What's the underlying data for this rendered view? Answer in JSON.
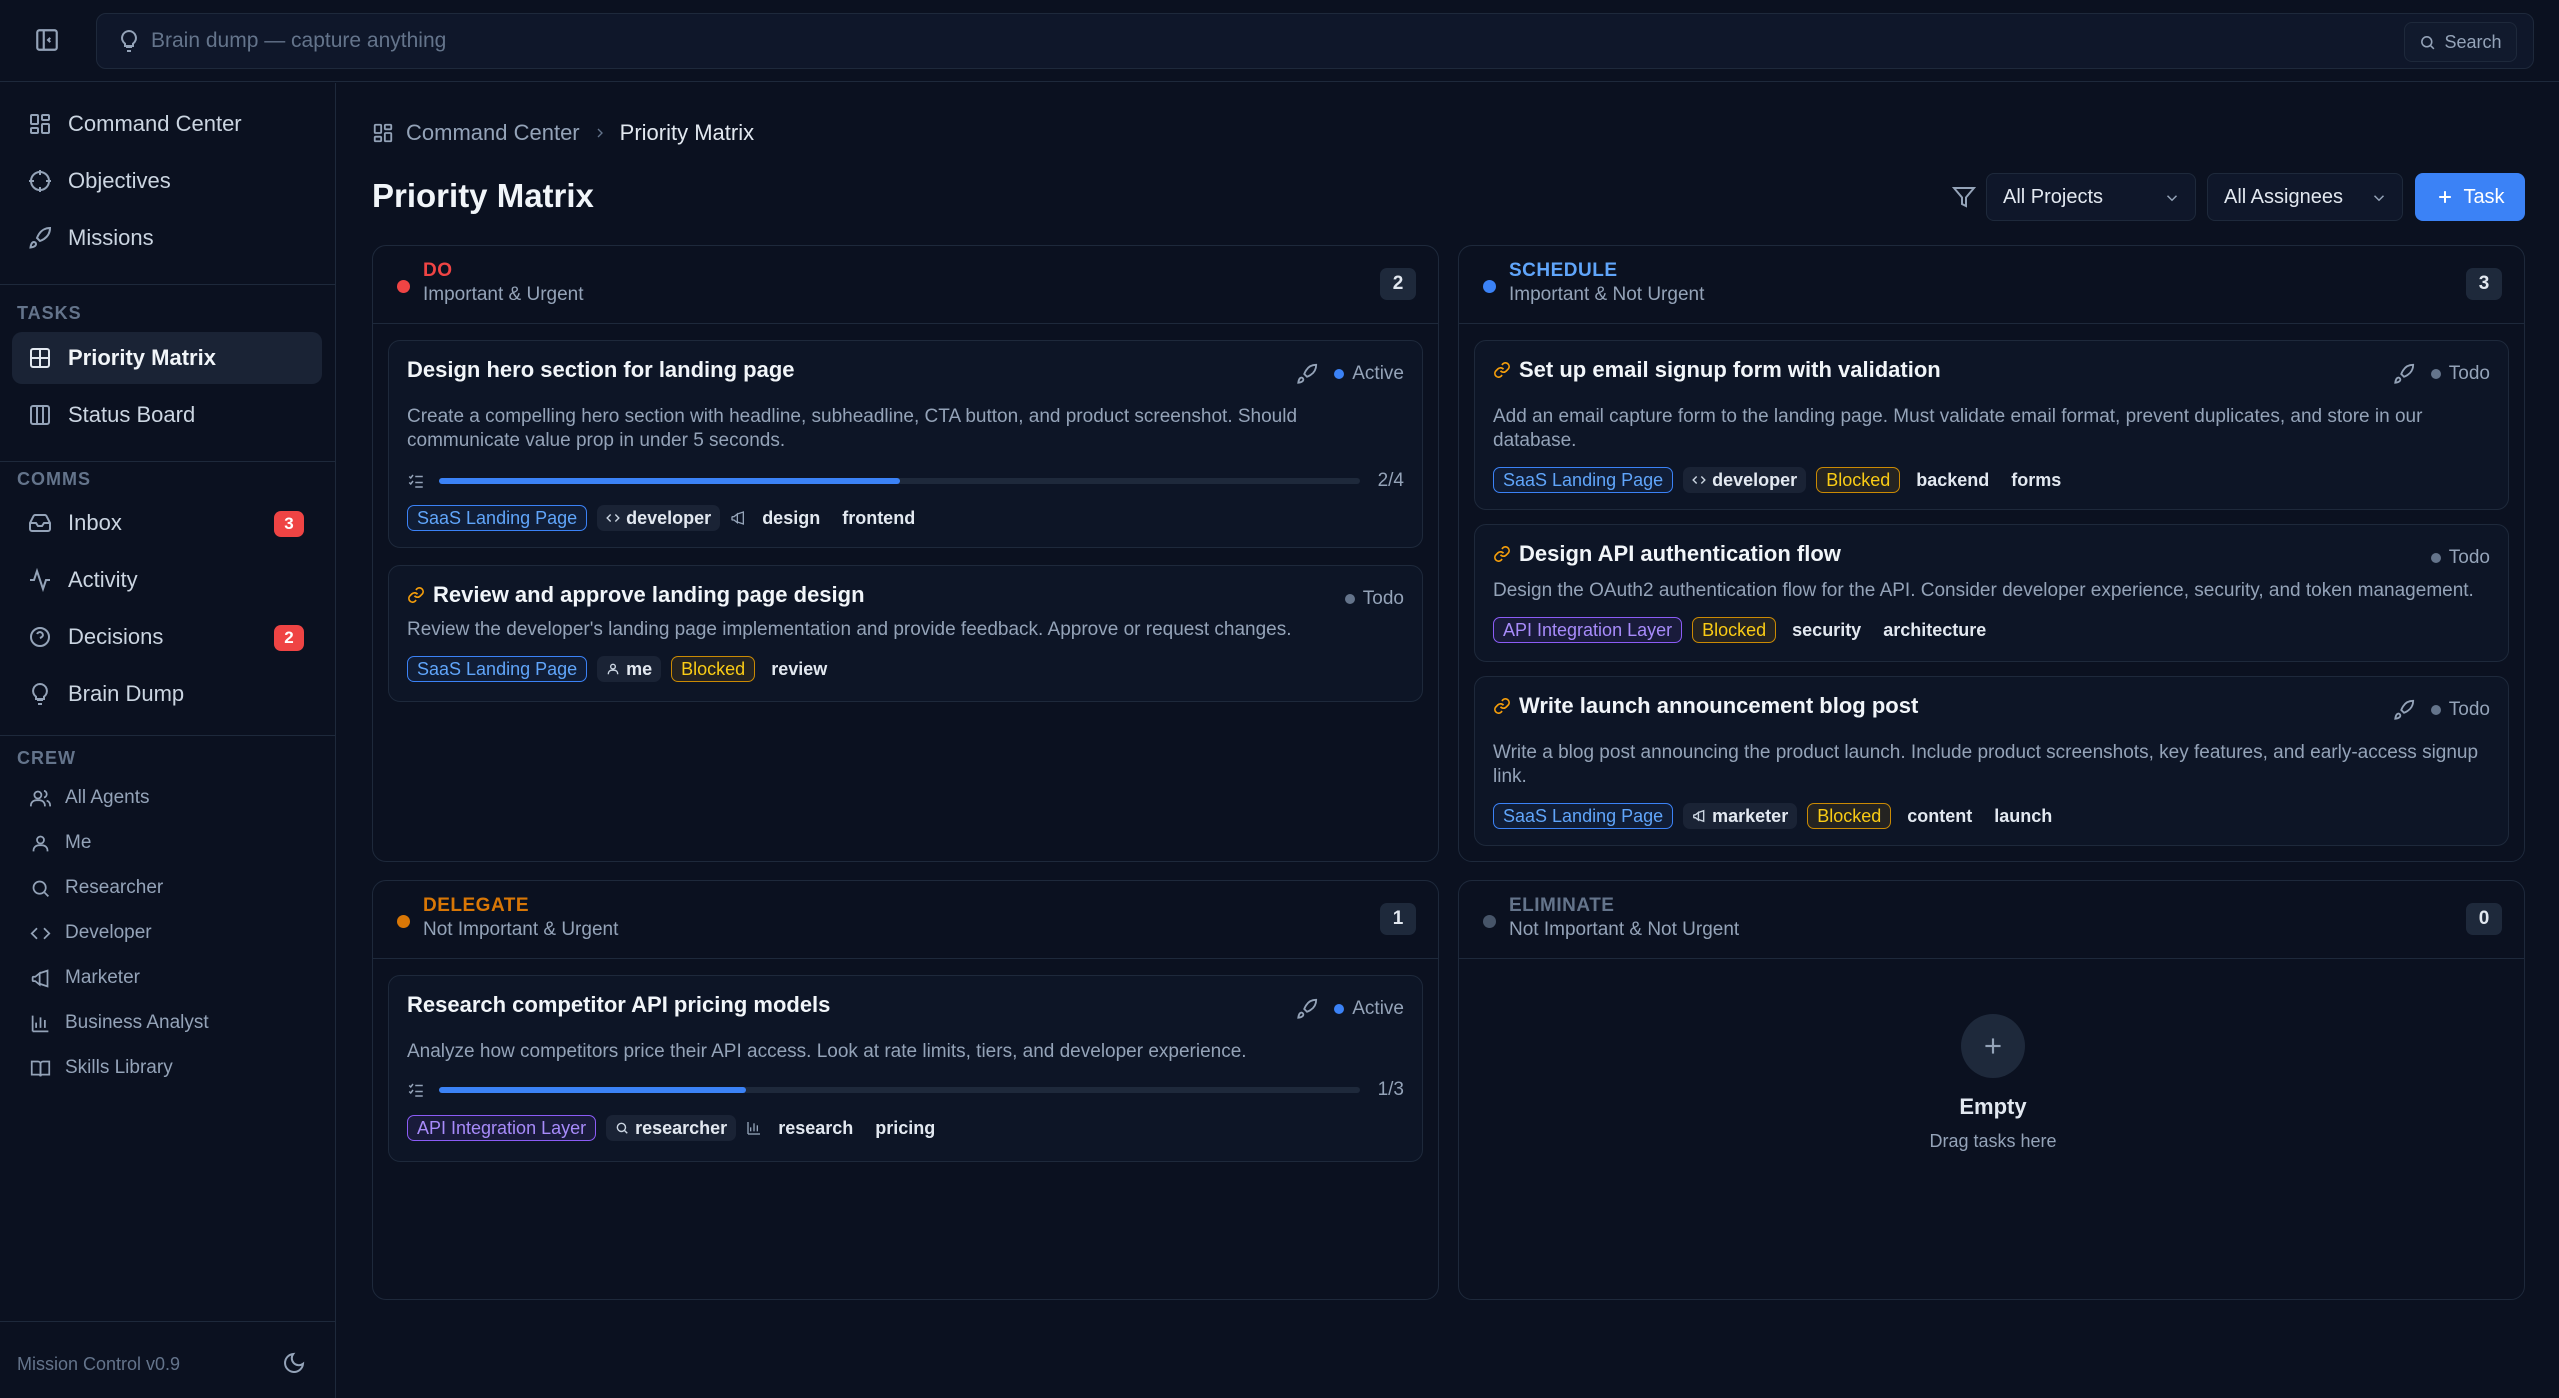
{
  "topbar": {
    "brain_dump_placeholder": "Brain dump — capture anything",
    "search_label": "Search"
  },
  "sidebar": {
    "main_items": [
      {
        "label": "Command Center",
        "icon": "grid-icon"
      },
      {
        "label": "Objectives",
        "icon": "target-icon"
      },
      {
        "label": "Missions",
        "icon": "rocket-icon"
      }
    ],
    "tasks_label": "TASKS",
    "task_items": [
      {
        "label": "Priority Matrix",
        "icon": "matrix-icon",
        "active": true
      },
      {
        "label": "Status Board",
        "icon": "columns-icon"
      }
    ],
    "comms_label": "COMMS",
    "comms_items": [
      {
        "label": "Inbox",
        "icon": "inbox-icon",
        "badge": "3"
      },
      {
        "label": "Activity",
        "icon": "activity-icon"
      },
      {
        "label": "Decisions",
        "icon": "help-circle-icon",
        "badge": "2"
      },
      {
        "label": "Brain Dump",
        "icon": "lightbulb-icon"
      }
    ],
    "crew_label": "CREW",
    "crew_items": [
      {
        "label": "All Agents",
        "icon": "users-icon"
      },
      {
        "label": "Me",
        "icon": "user-icon"
      },
      {
        "label": "Researcher",
        "icon": "search-icon"
      },
      {
        "label": "Developer",
        "icon": "code-icon"
      },
      {
        "label": "Marketer",
        "icon": "megaphone-icon"
      },
      {
        "label": "Business Analyst",
        "icon": "bar-chart-icon"
      },
      {
        "label": "Skills Library",
        "icon": "book-icon"
      }
    ],
    "footer": "Mission Control v0.9"
  },
  "header": {
    "breadcrumb_root": "Command Center",
    "breadcrumb_current": "Priority Matrix",
    "title": "Priority Matrix",
    "project_filter": "All Projects",
    "assignee_filter": "All Assignees",
    "new_task_label": "Task"
  },
  "quadrants": {
    "do": {
      "name": "DO",
      "subtitle": "Important & Urgent",
      "count": "2",
      "color": "#ef4444",
      "cards": [
        {
          "title": "Design hero section for landing page",
          "status": "Active",
          "description": "Create a compelling hero section with headline, subheadline, CTA button, and product screenshot. Should communicate value prop in under 5 seconds.",
          "progress_label": "2/4",
          "progress": 0.5,
          "project": "SaaS Landing Page",
          "assignee": "developer",
          "tags": [
            "design",
            "frontend"
          ]
        },
        {
          "title": "Review and approve landing page design",
          "status": "Todo",
          "description": "Review the developer's landing page implementation and provide feedback. Approve or request changes.",
          "project": "SaaS Landing Page",
          "assignee": "me",
          "blocked": "Blocked",
          "tags": [
            "review"
          ]
        }
      ]
    },
    "schedule": {
      "name": "SCHEDULE",
      "subtitle": "Important & Not Urgent",
      "count": "3",
      "color": "#3b82f6",
      "cards": [
        {
          "title": "Set up email signup form with validation",
          "status": "Todo",
          "description": "Add an email capture form to the landing page. Must validate email format, prevent duplicates, and store in our database.",
          "project": "SaaS Landing Page",
          "assignee": "developer",
          "blocked": "Blocked",
          "tags": [
            "backend",
            "forms"
          ]
        },
        {
          "title": "Design API authentication flow",
          "status": "Todo",
          "description": "Design the OAuth2 authentication flow for the API. Consider developer experience, security, and token management.",
          "project": "API Integration Layer",
          "blocked": "Blocked",
          "tags": [
            "security",
            "architecture"
          ]
        },
        {
          "title": "Write launch announcement blog post",
          "status": "Todo",
          "description": "Write a blog post announcing the product launch. Include product screenshots, key features, and early-access signup link.",
          "project": "SaaS Landing Page",
          "assignee": "marketer",
          "blocked": "Blocked",
          "tags": [
            "content",
            "launch"
          ]
        }
      ]
    },
    "delegate": {
      "name": "DELEGATE",
      "subtitle": "Not Important & Urgent",
      "count": "1",
      "color": "#d97706",
      "cards": [
        {
          "title": "Research competitor API pricing models",
          "status": "Active",
          "description": "Analyze how competitors price their API access. Look at rate limits, tiers, and developer experience.",
          "progress_label": "1/3",
          "progress": 0.333,
          "project": "API Integration Layer",
          "assignee": "researcher",
          "tags": [
            "research",
            "pricing"
          ]
        }
      ]
    },
    "eliminate": {
      "name": "ELIMINATE",
      "subtitle": "Not Important & Not Urgent",
      "count": "0",
      "color": "#475569",
      "empty_title": "Empty",
      "empty_subtitle": "Drag tasks here"
    }
  },
  "colors": {
    "accent": "#3b82f6",
    "active_dot": "#3b82f6",
    "todo_dot": "#64748b",
    "badge": "#ef4444"
  }
}
